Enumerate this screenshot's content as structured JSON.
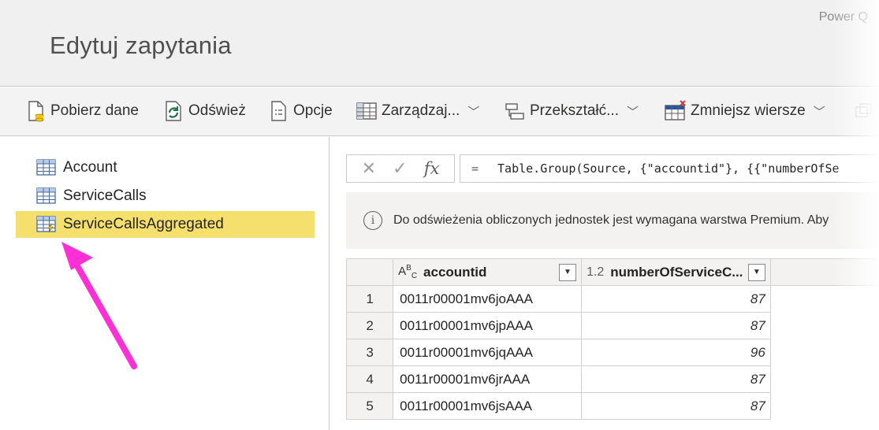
{
  "window": {
    "app_name": "Power Q",
    "title": "Edytuj zapytania"
  },
  "ribbon": {
    "get_data": "Pobierz dane",
    "refresh": "Odśwież",
    "options": "Opcje",
    "manage": "Zarządzaj...",
    "transform": "Przekształć...",
    "reduce_rows": "Zmniejsz wiersze"
  },
  "queries": [
    {
      "name": "Account",
      "icon": "table-icon"
    },
    {
      "name": "ServiceCalls",
      "icon": "table-icon"
    },
    {
      "name": "ServiceCallsAggregated",
      "icon": "computed-table-icon",
      "selected": true
    }
  ],
  "formula_bar": {
    "fx": "fx",
    "eq": "=",
    "formula": "Table.Group(Source, {\"accountid\"}, {{\"numberOfSe"
  },
  "info": {
    "message": "Do odświeżenia obliczonych jednostek jest wymagana warstwa Premium. Aby"
  },
  "table": {
    "columns": [
      {
        "type": "ABC",
        "name": "accountid"
      },
      {
        "type": "1.2",
        "name": "numberOfServiceC..."
      }
    ],
    "rows": [
      {
        "n": "1",
        "accountid": "0011r00001mv6joAAA",
        "value": "87"
      },
      {
        "n": "2",
        "accountid": "0011r00001mv6jpAAA",
        "value": "87"
      },
      {
        "n": "3",
        "accountid": "0011r00001mv6jqAAA",
        "value": "96"
      },
      {
        "n": "4",
        "accountid": "0011r00001mv6jrAAA",
        "value": "87"
      },
      {
        "n": "5",
        "accountid": "0011r00001mv6jsAAA",
        "value": "87"
      }
    ]
  },
  "colors": {
    "selected_query": "#f5e06e",
    "arrow": "#ff2fd6",
    "accent": "#217346"
  }
}
